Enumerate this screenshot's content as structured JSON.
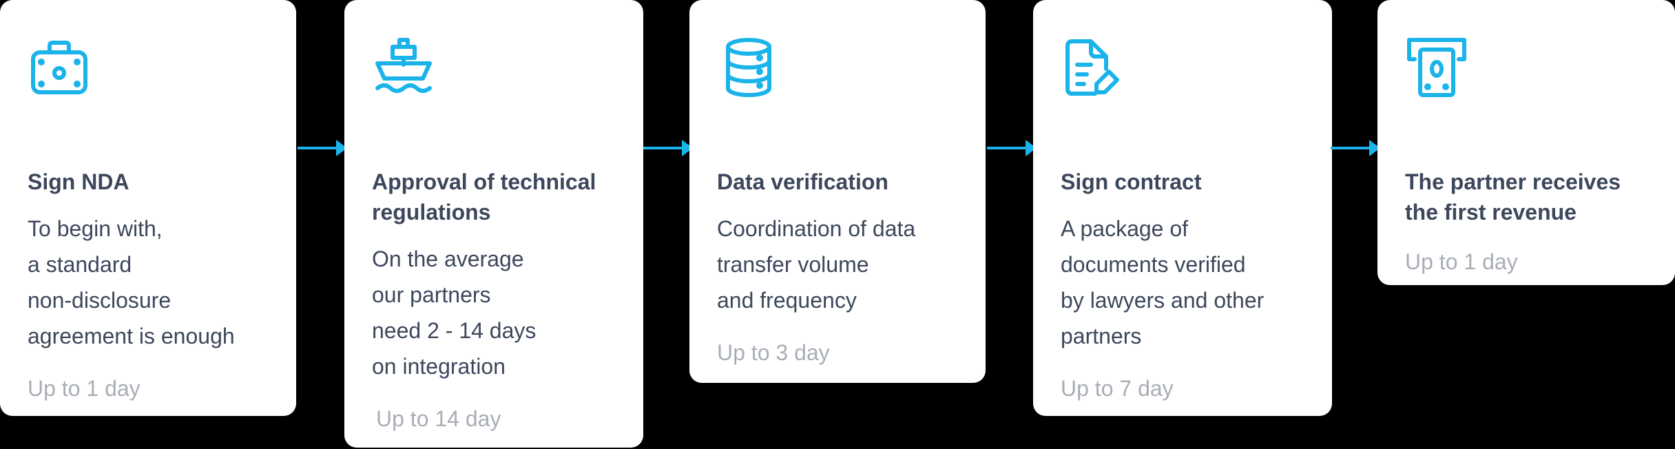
{
  "accent_color": "#1ab3ea",
  "steps": [
    {
      "icon": "briefcase-icon",
      "title": "Sign NDA",
      "description": "To begin with,\na standard\nnon-disclosure\nagreement is enough",
      "duration": "Up to 1 day"
    },
    {
      "icon": "ship-icon",
      "title": "Approval of technical regulations",
      "description": "On the average\nour partners\nneed 2 - 14 days\non integration",
      "duration": "Up to 14 day"
    },
    {
      "icon": "database-icon",
      "title": "Data verification",
      "description": "Coordination of data\ntransfer volume\nand frequency",
      "duration": "Up to 3 day"
    },
    {
      "icon": "document-edit-icon",
      "title": "Sign contract",
      "description": "A package of\ndocuments verified\nby lawyers and other\npartners",
      "duration": "Up to 7 day"
    },
    {
      "icon": "cash-withdrawal-icon",
      "title": "The partner receives the first revenue",
      "description": "",
      "duration": "Up to 1 day"
    }
  ]
}
